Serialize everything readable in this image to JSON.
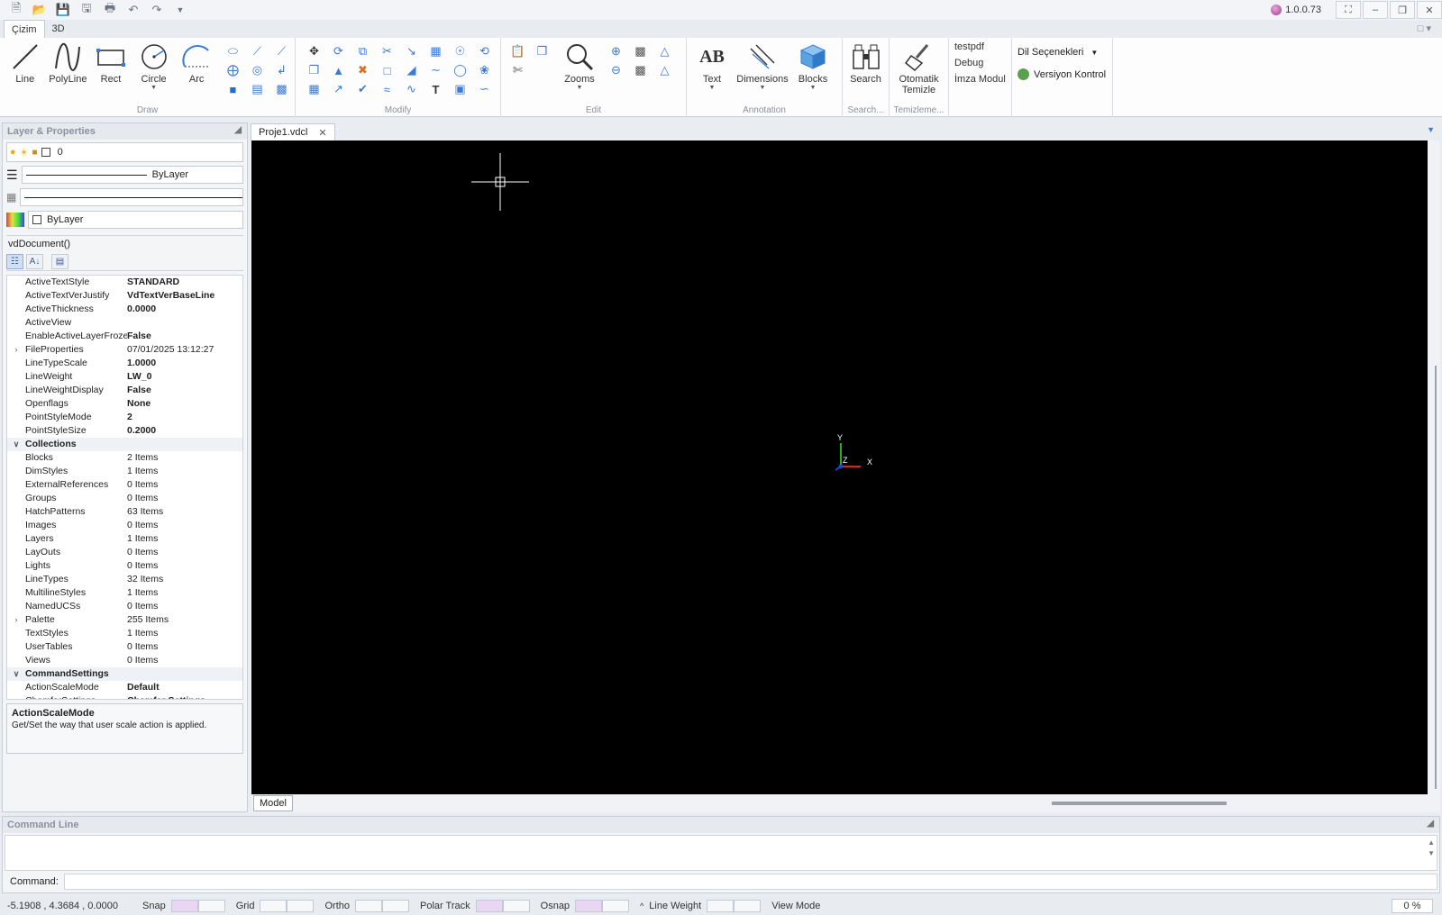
{
  "title_bar": {
    "version": "1.0.0.73",
    "qat_icons": [
      "new-file-icon",
      "open-icon",
      "save-icon",
      "save-as-icon",
      "print-icon",
      "undo-icon",
      "redo-icon",
      "customize-dropdown-icon"
    ]
  },
  "ribbon": {
    "tabs": [
      {
        "label": "Çizim",
        "active": true
      },
      {
        "label": "3D",
        "active": false
      }
    ],
    "groups": {
      "draw": {
        "label": "Draw",
        "buttons": [
          "Line",
          "PolyLine",
          "Rect",
          "Circle",
          "Arc"
        ]
      },
      "modify": {
        "label": "Modify"
      },
      "edit": {
        "label": "Edit",
        "zooms": "Zooms"
      },
      "annotation": {
        "label": "Annotation",
        "text": "Text",
        "dimensions": "Dimensions",
        "blocks": "Blocks"
      },
      "search": {
        "label": "Search...",
        "button": "Search"
      },
      "cleanup": {
        "label": "Temizleme...",
        "line1": "Otomatik",
        "line2": "Temizle"
      },
      "tools": {
        "links": [
          "testpdf",
          "Debug",
          "İmza Modul"
        ]
      },
      "language": {
        "dropdown": "Dil Seçenekleri",
        "version_control": "Versiyon Kontrol"
      }
    }
  },
  "left_panel": {
    "title": "Layer & Properties",
    "layer_name": "0",
    "linetype": "ByLayer",
    "color": "ByLayer",
    "document_title": "vdDocument()",
    "properties": [
      {
        "name": "ActiveTextStyle",
        "value": "STANDARD",
        "bold": true
      },
      {
        "name": "ActiveTextVerJustify",
        "value": "VdTextVerBaseLine",
        "bold": true
      },
      {
        "name": "ActiveThickness",
        "value": "0.0000",
        "bold": true
      },
      {
        "name": "ActiveView",
        "value": ""
      },
      {
        "name": "EnableActiveLayerFroze",
        "value": "False",
        "bold": true
      },
      {
        "name": "FileProperties",
        "value": "07/01/2025 13:12:27",
        "expand": ">"
      },
      {
        "name": "LineTypeScale",
        "value": "1.0000",
        "bold": true
      },
      {
        "name": "LineWeight",
        "value": "LW_0",
        "bold": true
      },
      {
        "name": "LineWeightDisplay",
        "value": "False",
        "bold": true
      },
      {
        "name": "Openflags",
        "value": "None",
        "bold": true
      },
      {
        "name": "PointStyleMode",
        "value": "2",
        "bold": true
      },
      {
        "name": "PointStyleSize",
        "value": "0.2000",
        "bold": true
      },
      {
        "name": "Collections",
        "value": "",
        "category": true,
        "expand": "v"
      },
      {
        "name": "Blocks",
        "value": "2 Items"
      },
      {
        "name": "DimStyles",
        "value": "1 Items"
      },
      {
        "name": "ExternalReferences",
        "value": "0 Items"
      },
      {
        "name": "Groups",
        "value": "0 Items"
      },
      {
        "name": "HatchPatterns",
        "value": "63 Items"
      },
      {
        "name": "Images",
        "value": "0 Items"
      },
      {
        "name": "Layers",
        "value": "1 Items"
      },
      {
        "name": "LayOuts",
        "value": "0 Items"
      },
      {
        "name": "Lights",
        "value": "0 Items"
      },
      {
        "name": "LineTypes",
        "value": "32 Items"
      },
      {
        "name": "MultilineStyles",
        "value": "1 Items"
      },
      {
        "name": "NamedUCSs",
        "value": "0 Items"
      },
      {
        "name": "Palette",
        "value": "255 Items",
        "expand": ">"
      },
      {
        "name": "TextStyles",
        "value": "1 Items"
      },
      {
        "name": "UserTables",
        "value": "0 Items"
      },
      {
        "name": "Views",
        "value": "0 Items"
      },
      {
        "name": "CommandSettings",
        "value": "",
        "category": true,
        "expand": "v"
      },
      {
        "name": "ActionScaleMode",
        "value": "Default",
        "bold": true
      },
      {
        "name": "ChamferSettings",
        "value": "Chamfer Settings",
        "bold": true,
        "expand": ">"
      }
    ],
    "description": {
      "title": "ActionScaleMode",
      "text": "Get/Set the way that user scale action is applied."
    }
  },
  "document": {
    "tab": "Proje1.vdcl",
    "model_tab": "Model",
    "axis": {
      "x": "X",
      "y": "Y",
      "z": "Z"
    }
  },
  "command_line": {
    "title": "Command Line",
    "label": "Command:",
    "value": ""
  },
  "status_bar": {
    "coords": "-5.1908 , 4.3684 , 0.0000",
    "toggles": [
      "Snap",
      "Grid",
      "Ortho",
      "Polar Track",
      "Osnap",
      "Line Weight"
    ],
    "view_mode": "View Mode",
    "zoom": "0 %"
  },
  "colors": {
    "canvas": "#000000",
    "accent": "#3a7bd5",
    "axis_x": "#e02020",
    "axis_y": "#20b020",
    "axis_z": "#2040e0"
  }
}
